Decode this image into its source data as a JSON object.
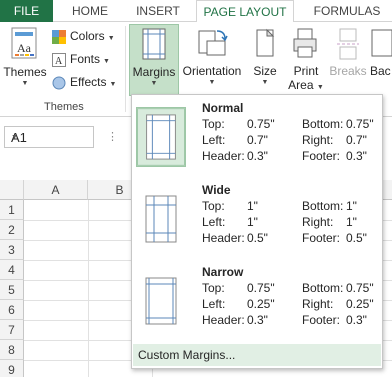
{
  "tabs": {
    "file": "FILE",
    "home": "HOME",
    "insert": "INSERT",
    "page_layout": "PAGE LAYOUT",
    "formulas": "FORMULAS"
  },
  "ribbon": {
    "themes_label": "Themes",
    "colors_label": "Colors",
    "fonts_label": "Fonts",
    "effects_label": "Effects",
    "themes_group": "Themes",
    "margins_label": "Margins",
    "orientation_label": "Orientation",
    "size_label": "Size",
    "print_area_label_1": "Print",
    "print_area_label_2": "Area",
    "breaks_label": "Breaks",
    "background_label": "Bac"
  },
  "namebox": {
    "value": "A1"
  },
  "grid": {
    "columns": [
      "A",
      "B"
    ],
    "rows": [
      "1",
      "2",
      "3",
      "4",
      "5",
      "6",
      "7",
      "8",
      "9"
    ]
  },
  "margins_menu": {
    "presets": [
      {
        "name": "Normal",
        "top": "0.75\"",
        "bottom": "0.75\"",
        "left": "0.7\"",
        "right": "0.7\"",
        "header": "0.3\"",
        "footer": "0.3\""
      },
      {
        "name": "Wide",
        "top": "1\"",
        "bottom": "1\"",
        "left": "1\"",
        "right": "1\"",
        "header": "0.5\"",
        "footer": "0.5\""
      },
      {
        "name": "Narrow",
        "top": "0.75\"",
        "bottom": "0.75\"",
        "left": "0.25\"",
        "right": "0.25\"",
        "header": "0.3\"",
        "footer": "0.3\""
      }
    ],
    "labels": {
      "top": "Top:",
      "bottom": "Bottom:",
      "left": "Left:",
      "right": "Right:",
      "header": "Header:",
      "footer": "Footer:"
    },
    "custom_label": "Custom Margins..."
  },
  "colors": {
    "accent": "#217346",
    "selected_bg": "#c5e0c9",
    "hover_bg": "#e1efe4"
  }
}
